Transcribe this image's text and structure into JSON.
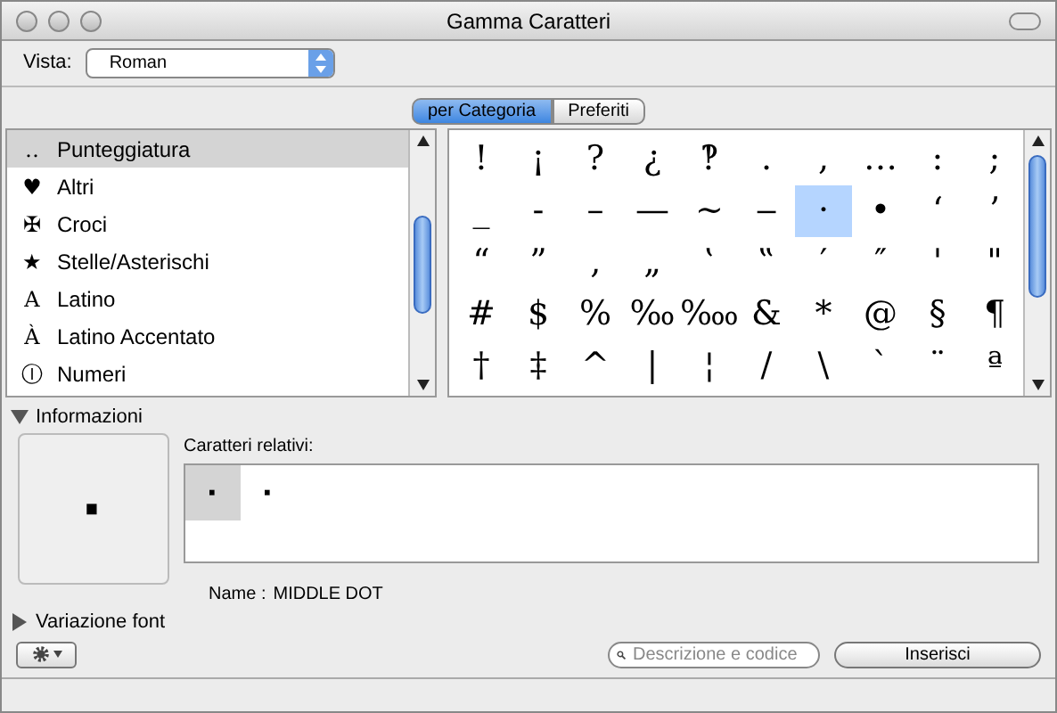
{
  "window": {
    "title": "Gamma Caratteri"
  },
  "view": {
    "label": "Vista:",
    "value": "Roman"
  },
  "tabs": [
    {
      "label": "per Categoria",
      "selected": true
    },
    {
      "label": "Preferiti",
      "selected": false
    }
  ],
  "categories": [
    {
      "icon": "‥",
      "label": "Punteggiatura",
      "selected": true
    },
    {
      "icon": "♥",
      "label": "Altri",
      "selected": false
    },
    {
      "icon": "✠",
      "label": "Croci",
      "selected": false
    },
    {
      "icon": "★",
      "label": "Stelle/Asterischi",
      "selected": false
    },
    {
      "icon": "A",
      "label": "Latino",
      "selected": false
    },
    {
      "icon": "À",
      "label": "Latino Accentato",
      "selected": false
    },
    {
      "icon": "Ⓘ",
      "label": "Numeri",
      "selected": false
    }
  ],
  "characters": [
    [
      {
        "char": "!",
        "selected": false
      },
      {
        "char": "¡",
        "selected": false
      },
      {
        "char": "?",
        "selected": false
      },
      {
        "char": "¿",
        "selected": false
      },
      {
        "char": "‽",
        "selected": false
      },
      {
        "char": ".",
        "selected": false
      },
      {
        "char": ",",
        "selected": false
      },
      {
        "char": "…",
        "selected": false
      },
      {
        "char": ":",
        "selected": false
      },
      {
        "char": ";",
        "selected": false
      }
    ],
    [
      {
        "char": "_",
        "selected": false
      },
      {
        "char": "‐",
        "selected": false
      },
      {
        "char": "–",
        "selected": false
      },
      {
        "char": "—",
        "selected": false
      },
      {
        "char": "~",
        "selected": false
      },
      {
        "char": "‒",
        "selected": false
      },
      {
        "char": "·",
        "selected": true
      },
      {
        "char": "•",
        "selected": false
      },
      {
        "char": "‘",
        "selected": false
      },
      {
        "char": "’",
        "selected": false
      }
    ],
    [
      {
        "char": "“",
        "selected": false
      },
      {
        "char": "”",
        "selected": false
      },
      {
        "char": "‚",
        "selected": false
      },
      {
        "char": "„",
        "selected": false
      },
      {
        "char": "‛",
        "selected": false
      },
      {
        "char": "‟",
        "selected": false
      },
      {
        "char": "′",
        "selected": false
      },
      {
        "char": "″",
        "selected": false
      },
      {
        "char": "'",
        "selected": false
      },
      {
        "char": "\"",
        "selected": false
      }
    ],
    [
      {
        "char": "#",
        "selected": false
      },
      {
        "char": "$",
        "selected": false
      },
      {
        "char": "%",
        "selected": false
      },
      {
        "char": "‰",
        "selected": false
      },
      {
        "char": "‱",
        "selected": false
      },
      {
        "char": "&",
        "selected": false
      },
      {
        "char": "*",
        "selected": false
      },
      {
        "char": "@",
        "selected": false
      },
      {
        "char": "§",
        "selected": false
      },
      {
        "char": "¶",
        "selected": false
      }
    ],
    [
      {
        "char": "†",
        "selected": false
      },
      {
        "char": "‡",
        "selected": false
      },
      {
        "char": "^",
        "selected": false
      },
      {
        "char": "|",
        "selected": false
      },
      {
        "char": "¦",
        "selected": false
      },
      {
        "char": "/",
        "selected": false
      },
      {
        "char": "\\",
        "selected": false
      },
      {
        "char": "`",
        "selected": false
      },
      {
        "char": "¨",
        "selected": false
      },
      {
        "char": "ª",
        "selected": false
      }
    ]
  ],
  "info": {
    "label": "Informazioni",
    "expanded": true,
    "preview": "·",
    "related_label": "Caratteri relativi:",
    "related": [
      {
        "char": "·",
        "selected": true
      },
      {
        "char": "·",
        "selected": false
      }
    ],
    "name_label": "Name :",
    "name": "MIDDLE DOT"
  },
  "font_variation": {
    "label": "Variazione font",
    "expanded": false
  },
  "search": {
    "placeholder": "Descrizione e codice"
  },
  "insert_button": "Inserisci"
}
